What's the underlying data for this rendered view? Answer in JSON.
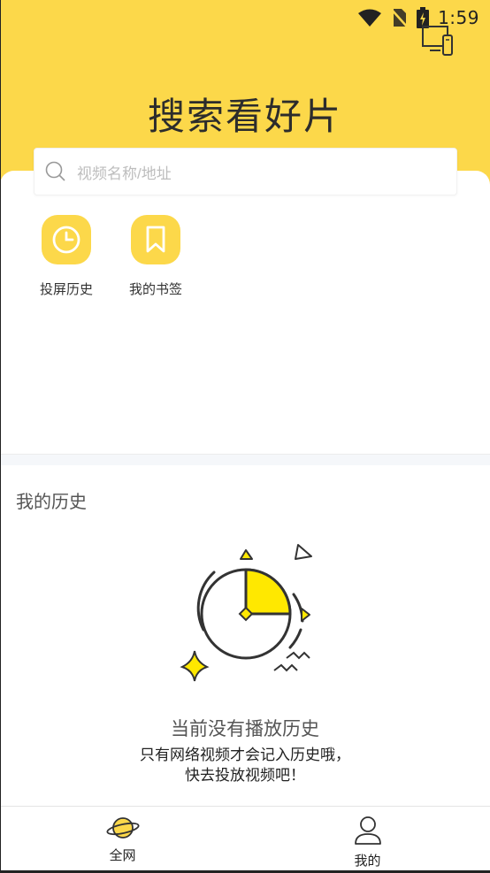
{
  "status_bar": {
    "time": "1:59",
    "icons": [
      "wifi-icon",
      "no-sim-icon",
      "battery-charging-icon"
    ]
  },
  "header": {
    "title": "搜索看好片",
    "cast_icon": "cast-screen-icon"
  },
  "search": {
    "placeholder": "视频名称/地址",
    "icon": "search-icon"
  },
  "quick_actions": [
    {
      "label": "投屏历史",
      "icon": "clock-icon"
    },
    {
      "label": "我的书签",
      "icon": "bookmark-icon"
    }
  ],
  "history": {
    "title": "我的历史",
    "empty_title": "当前没有播放历史",
    "empty_line1": "只有网络视频才会记入历史哦，",
    "empty_line2": "快去投放视频吧！"
  },
  "bottom_nav": [
    {
      "label": "全网",
      "icon": "planet-icon"
    },
    {
      "label": "我的",
      "icon": "user-icon"
    }
  ],
  "colors": {
    "accent": "#FCD84A",
    "illustration_yellow": "#FFE800"
  }
}
